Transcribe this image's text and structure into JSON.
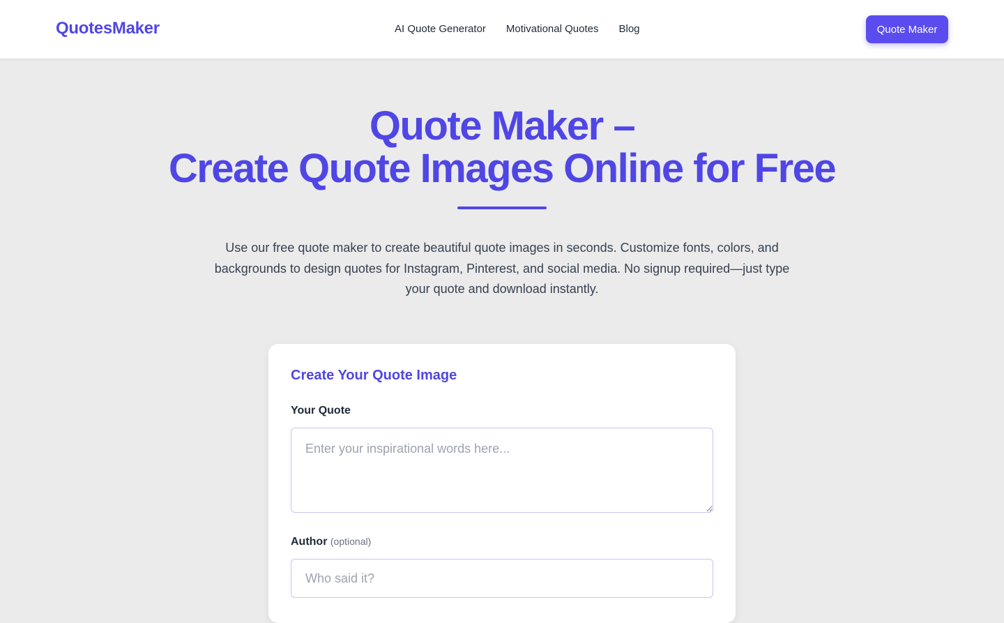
{
  "header": {
    "logo": "QuotesMaker",
    "nav": [
      {
        "label": "AI Quote Generator"
      },
      {
        "label": "Motivational Quotes"
      },
      {
        "label": "Blog"
      }
    ],
    "cta_label": "Quote Maker"
  },
  "hero": {
    "title_line1": "Quote Maker –",
    "title_line2": "Create Quote Images Online for Free",
    "intro": "Use our free quote maker to create beautiful quote images in seconds. Customize fonts, colors, and backgrounds to design quotes for Instagram, Pinterest, and social media. No signup required—just type your quote and download instantly."
  },
  "form": {
    "title": "Create Your Quote Image",
    "quote_label": "Your Quote",
    "quote_value": "",
    "quote_placeholder": "Enter your inspirational words here...",
    "author_label": "Author",
    "author_optional": "(optional)",
    "author_value": "",
    "author_placeholder": "Who said it?"
  },
  "colors": {
    "brand": "#4f46e5",
    "button": "#5b4cf0",
    "page_background": "#ebebeb"
  }
}
